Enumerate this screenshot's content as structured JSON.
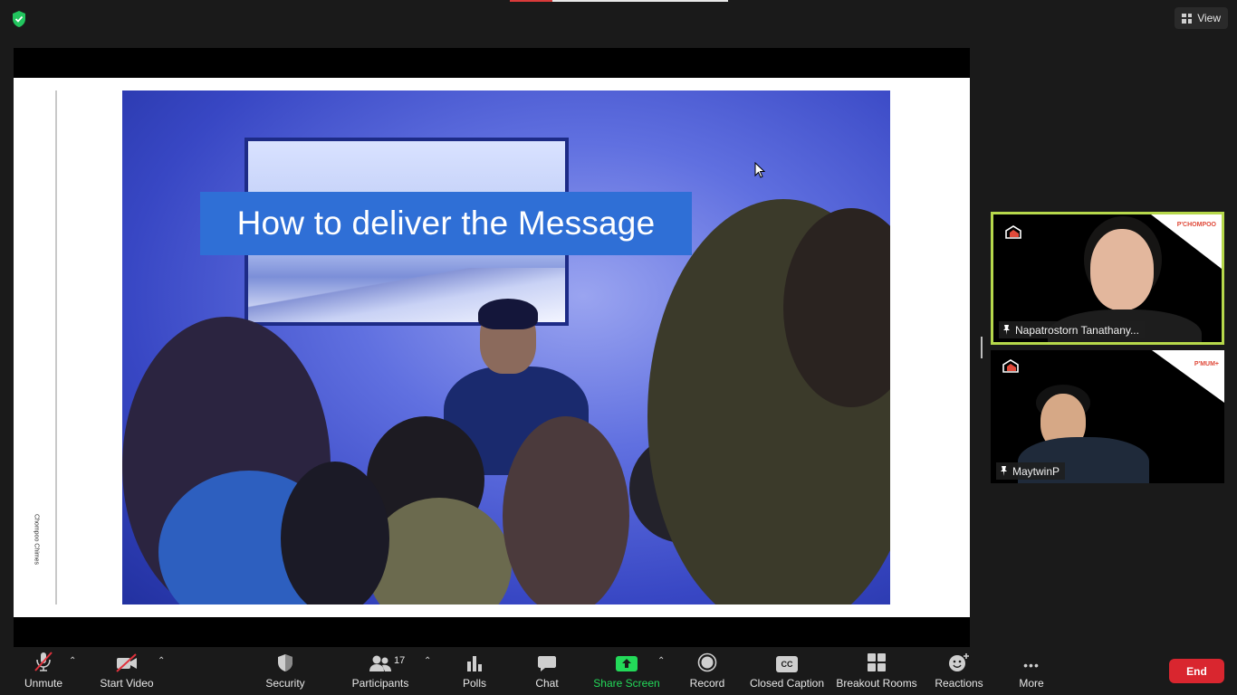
{
  "top_bar": {
    "view_label": "View",
    "shield_icon": "encryption-shield-icon",
    "shield_color": "#22c55e"
  },
  "shared_screen": {
    "slide_title": "How to deliver the Message",
    "side_credit": "Chompoo Chimes"
  },
  "participants": [
    {
      "name": "Napatrostorn Tanathany...",
      "corner_brand": "P'CHOMPOO",
      "active_speaker": true,
      "highlight_color": "#b6d84b"
    },
    {
      "name": "MaytwinP",
      "corner_brand": "P'MUM+",
      "active_speaker": false
    }
  ],
  "toolbar": {
    "unmute": "Unmute",
    "start_video": "Start Video",
    "security": "Security",
    "participants": "Participants",
    "participants_count": "17",
    "polls": "Polls",
    "chat": "Chat",
    "share_screen": "Share Screen",
    "record": "Record",
    "closed_caption": "Closed Caption",
    "breakout_rooms": "Breakout Rooms",
    "reactions": "Reactions",
    "more": "More",
    "end": "End",
    "cc_glyph": "CC",
    "more_glyph": "•••"
  },
  "colors": {
    "share_green": "#23d959",
    "end_red": "#d9262f",
    "muted_red": "#e0313c"
  }
}
